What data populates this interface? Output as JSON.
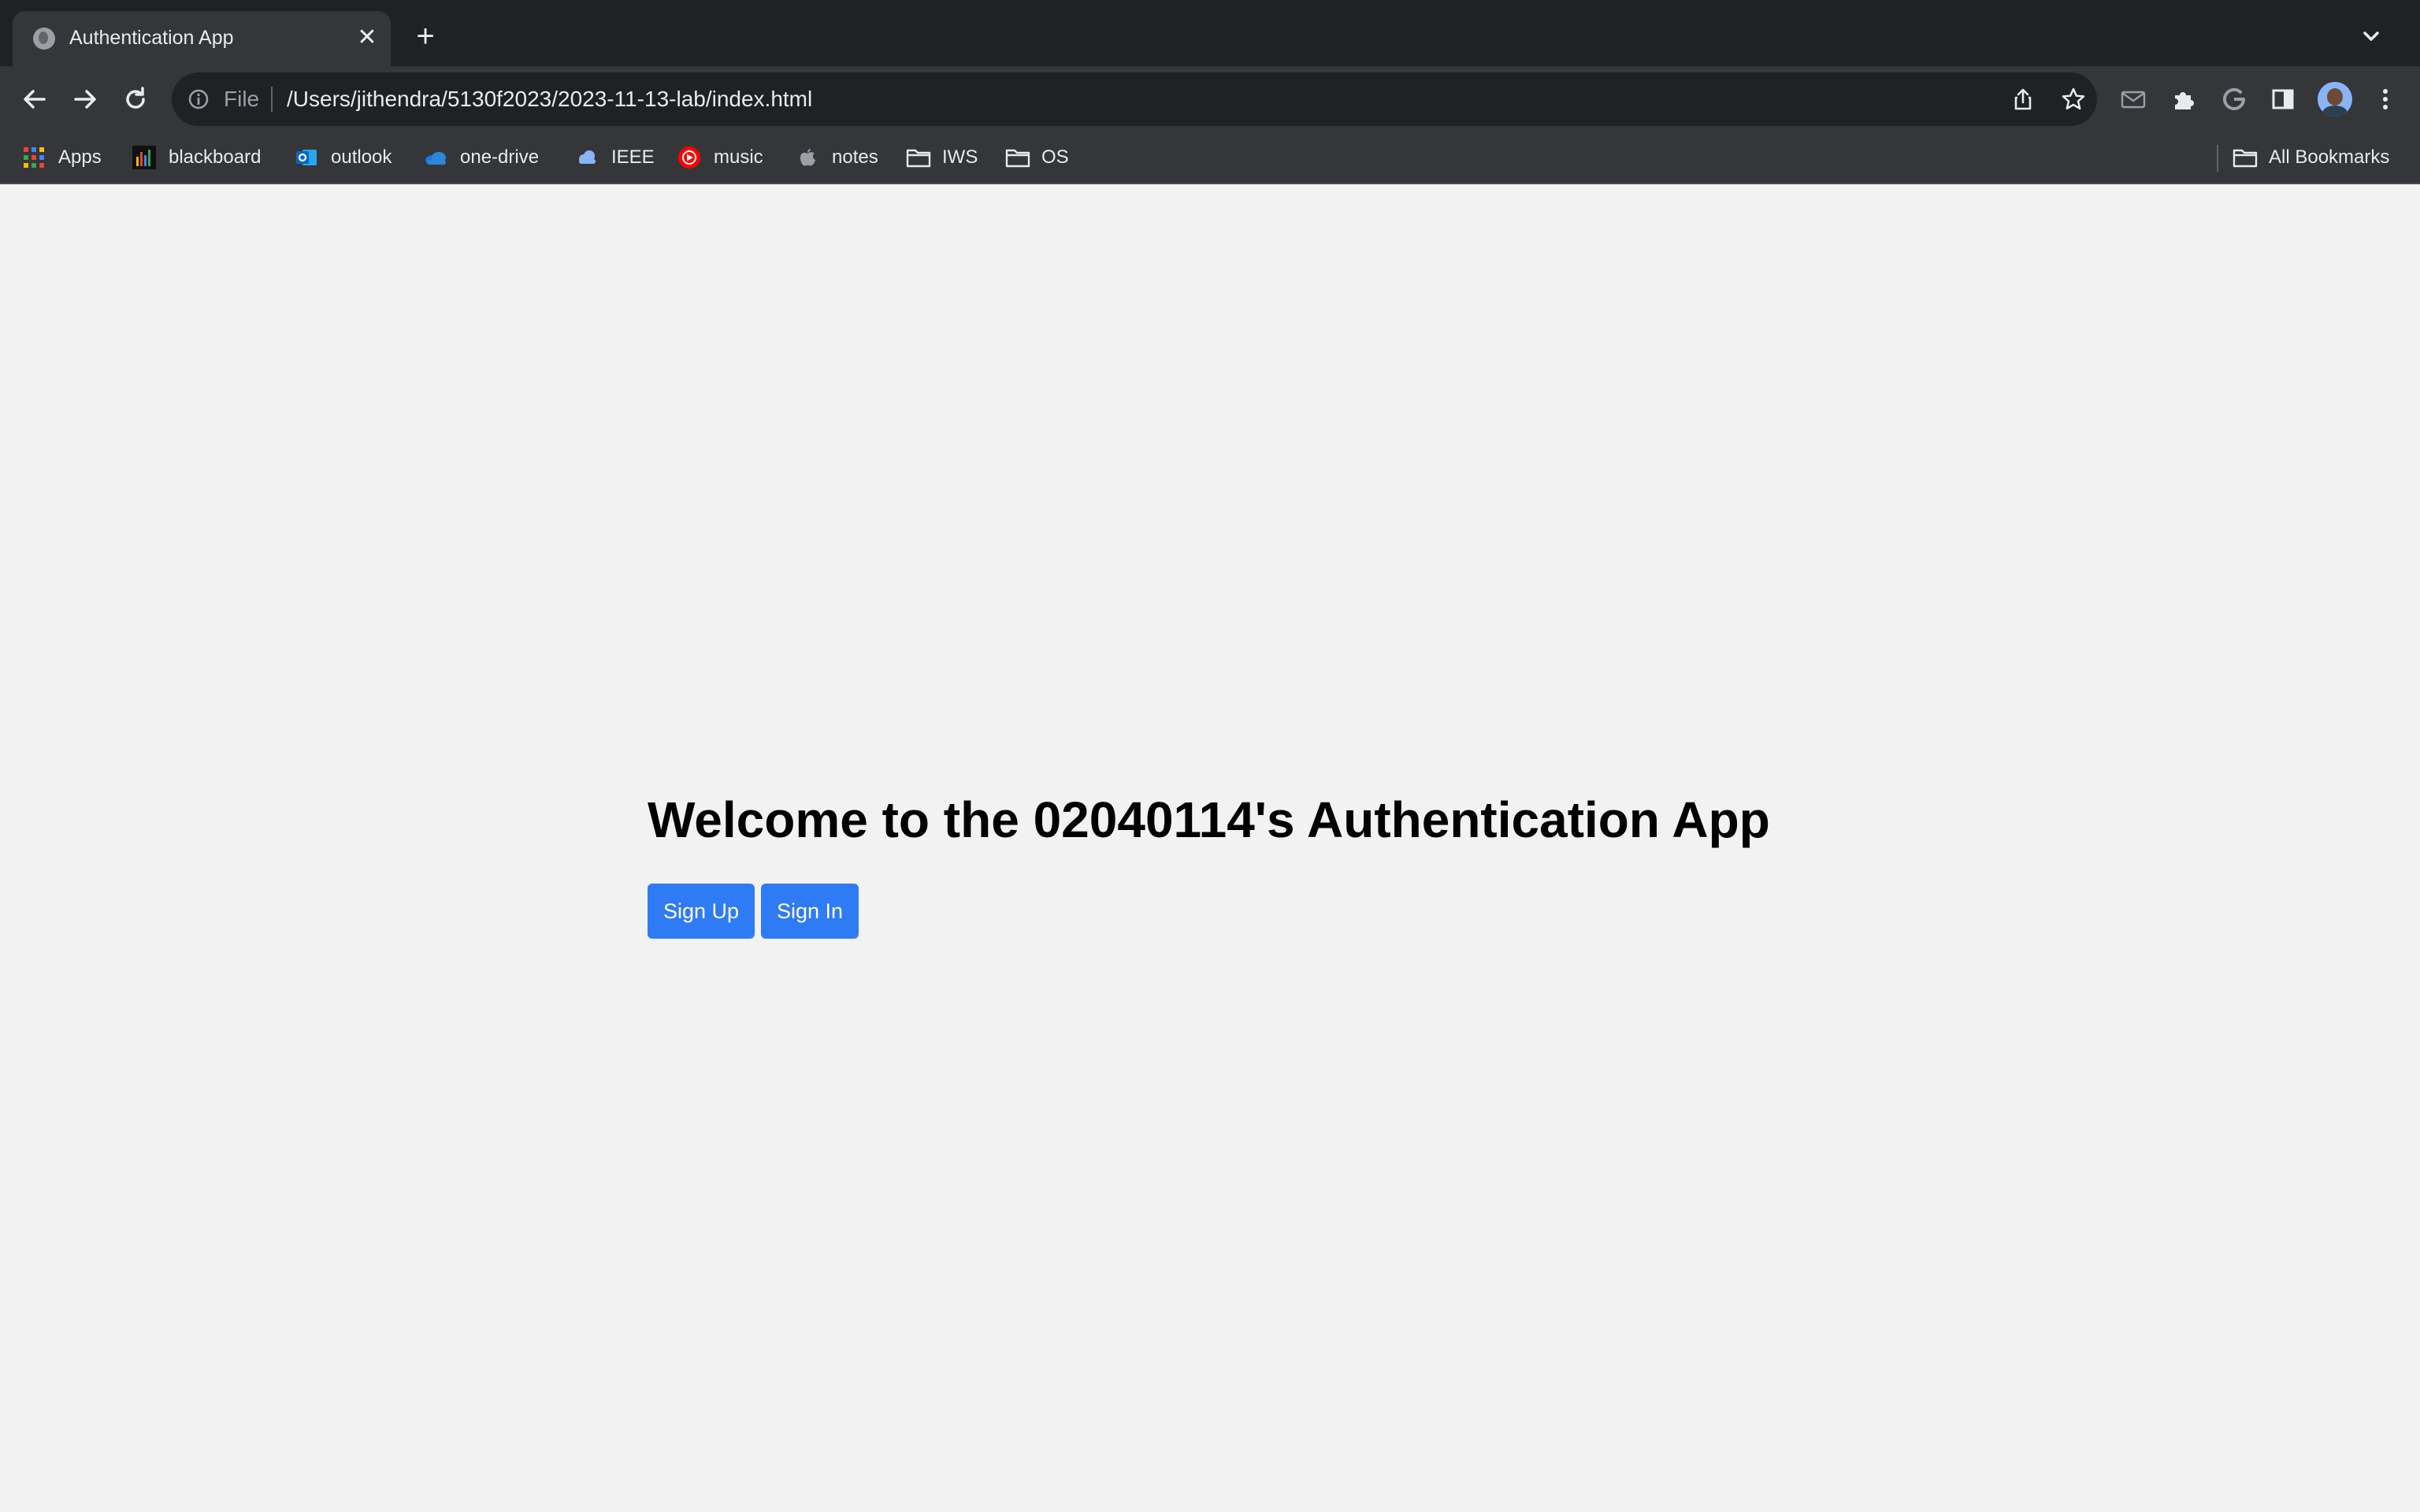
{
  "browser": {
    "tab": {
      "title": "Authentication App"
    },
    "omnibox": {
      "scheme": "File",
      "path": "/Users/jithendra/5130f2023/2023-11-13-lab/index.html"
    },
    "bookmarks": [
      {
        "label": "Apps",
        "icon": "apps-grid-icon"
      },
      {
        "label": "blackboard",
        "icon": "blackboard-icon"
      },
      {
        "label": "outlook",
        "icon": "outlook-icon"
      },
      {
        "label": "one-drive",
        "icon": "onedrive-cloud-icon"
      },
      {
        "label": "IEEE",
        "icon": "cloud-icon"
      },
      {
        "label": "music",
        "icon": "youtube-music-icon"
      },
      {
        "label": "notes",
        "icon": "apple-icon"
      },
      {
        "label": "IWS",
        "icon": "folder-icon"
      },
      {
        "label": "OS",
        "icon": "folder-icon"
      }
    ],
    "all_bookmarks": "All Bookmarks"
  },
  "page": {
    "heading": "Welcome to the 02040114's Authentication App",
    "signup_label": "Sign Up",
    "signin_label": "Sign In"
  },
  "colors": {
    "button": "#2f7bf5",
    "page_background": "#f2f2f2",
    "toolbar": "#35363a",
    "tabstrip": "#202124"
  }
}
